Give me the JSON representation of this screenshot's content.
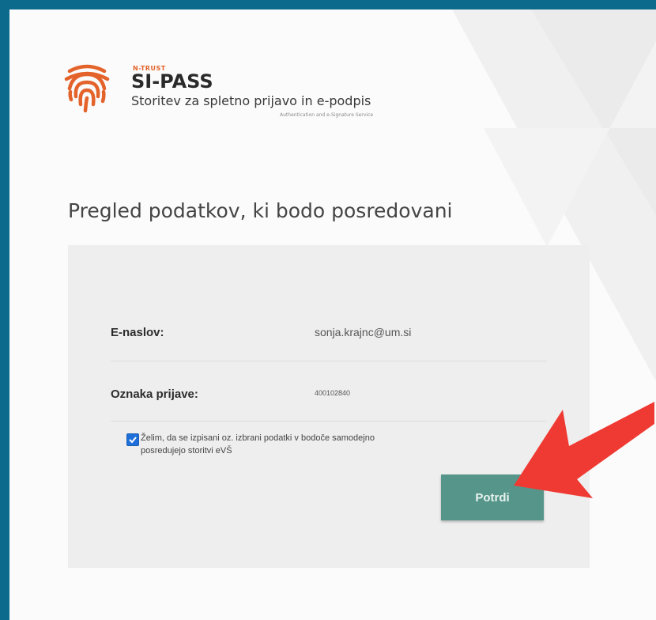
{
  "logo": {
    "brand": "N-TRUST",
    "name": "SI-PASS",
    "tagline": "Storitev za spletno prijavo in e-podpis",
    "subtagline": "Authentication and e-Signature Service"
  },
  "page_title": "Pregled podatkov, ki bodo posredovani",
  "fields": [
    {
      "label": "E-naslov:",
      "value": "sonja.krajnc@um.si"
    },
    {
      "label": "Oznaka prijave:",
      "value": "400102840"
    }
  ],
  "consent": {
    "checked": true,
    "text": "Želim, da se izpisani oz. izbrani podatki v bodoče samodejno posredujejo storitvi eVŠ"
  },
  "confirm_button": {
    "label": "Potrdi"
  },
  "colors": {
    "frame": "#0c6a8c",
    "accent": "#e4632a",
    "button": "#56968a",
    "arrow": "#ef3a33",
    "checkbox": "#1e6fd9"
  },
  "icons": {
    "logo": "fingerprint-icon",
    "annotation": "red-arrow-icon"
  }
}
